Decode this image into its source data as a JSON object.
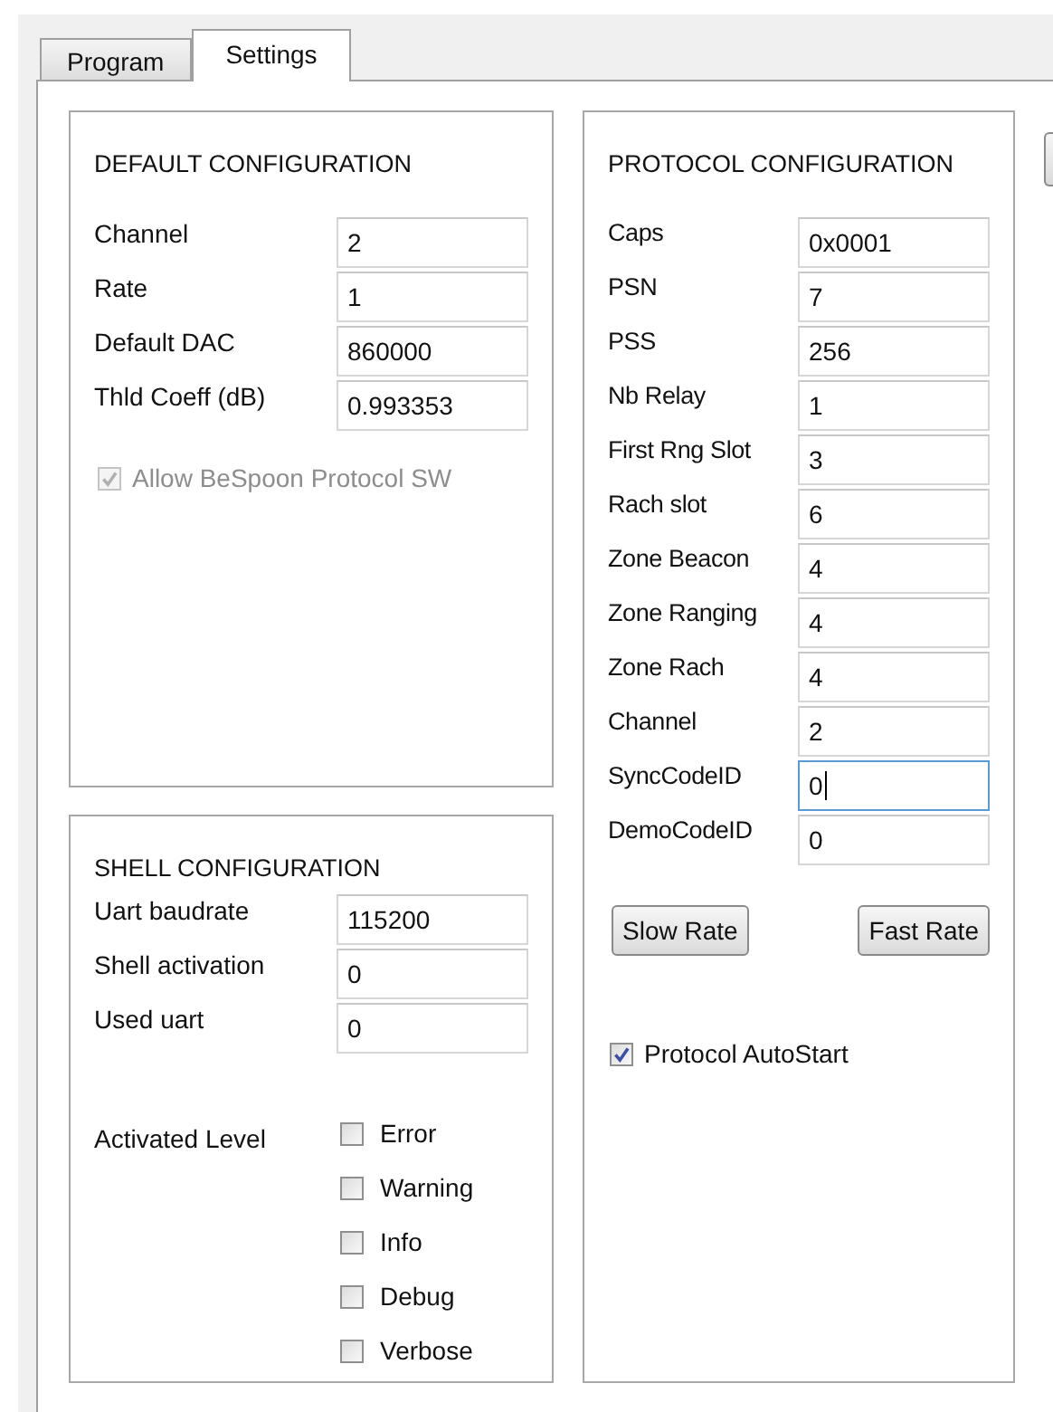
{
  "tabs": [
    {
      "label": "Program",
      "selected": false
    },
    {
      "label": "Settings",
      "selected": true
    }
  ],
  "default_configuration": {
    "title": "DEFAULT CONFIGURATION",
    "fields": [
      {
        "label": "Channel",
        "value": "2"
      },
      {
        "label": "Rate",
        "value": "1"
      },
      {
        "label": "Default DAC",
        "value": "860000"
      },
      {
        "label": "Thld Coeff (dB)",
        "value": "0.993353"
      }
    ],
    "checkbox": {
      "label": "Allow BeSpoon Protocol SW",
      "checked": true,
      "disabled": true
    }
  },
  "shell_configuration": {
    "title": "SHELL CONFIGURATION",
    "fields": [
      {
        "label": "Uart baudrate",
        "value": "115200"
      },
      {
        "label": "Shell activation",
        "value": "0"
      },
      {
        "label": "Used uart",
        "value": "0"
      }
    ],
    "activated_level": {
      "label": "Activated Level",
      "options": [
        {
          "label": "Error",
          "checked": false
        },
        {
          "label": "Warning",
          "checked": false
        },
        {
          "label": "Info",
          "checked": false
        },
        {
          "label": "Debug",
          "checked": false
        },
        {
          "label": "Verbose",
          "checked": false
        }
      ]
    }
  },
  "protocol_configuration": {
    "title": "PROTOCOL CONFIGURATION",
    "fields": [
      {
        "label": "Caps",
        "value": "0x0001",
        "focused": false
      },
      {
        "label": "PSN",
        "value": "7",
        "focused": false
      },
      {
        "label": "PSS",
        "value": "256",
        "focused": false
      },
      {
        "label": "Nb Relay",
        "value": "1",
        "focused": false
      },
      {
        "label": "First Rng Slot",
        "value": "3",
        "focused": false
      },
      {
        "label": "Rach slot",
        "value": "6",
        "focused": false
      },
      {
        "label": "Zone Beacon",
        "value": "4",
        "focused": false
      },
      {
        "label": "Zone Ranging",
        "value": "4",
        "focused": false
      },
      {
        "label": "Zone Rach",
        "value": "4",
        "focused": false
      },
      {
        "label": "Channel",
        "value": "2",
        "focused": false
      },
      {
        "label": "SyncCodeID",
        "value": "0",
        "focused": true
      },
      {
        "label": "DemoCodeID",
        "value": "0",
        "focused": false
      }
    ],
    "buttons": [
      "Slow Rate",
      "Fast Rate"
    ],
    "checkbox": {
      "label": "Protocol AutoStart",
      "checked": true
    }
  }
}
